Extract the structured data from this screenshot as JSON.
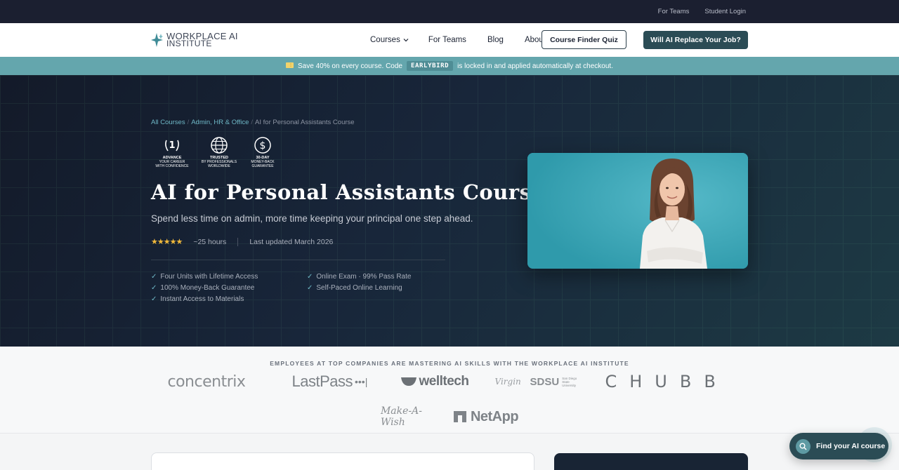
{
  "topbar": {
    "for_teams": "For Teams",
    "student_login": "Student Login"
  },
  "nav": {
    "logo_line1": "WORKPLACE AI",
    "logo_line2": "INSTITUTE",
    "courses": "Courses",
    "for_teams": "For Teams",
    "blog": "Blog",
    "about": "About",
    "quiz_button": "Course Finder Quiz",
    "cta_button": "Will AI Replace Your Job?"
  },
  "promo": {
    "before": "Save 40% on every course. Code",
    "code": "EARLYBIRD",
    "after": "is locked in and applied automatically at checkout."
  },
  "hero": {
    "breadcrumb": {
      "level1": "All Courses",
      "sep": "/",
      "level2": "Admin, HR & Office",
      "current": "AI for Personal Assistants Course"
    },
    "badges": [
      {
        "icon": "laurel-number-one-icon",
        "line1": "ADVANCE",
        "line2": "YOUR CAREER",
        "line3": "WITH CONFIDENCE"
      },
      {
        "icon": "globe-icon",
        "line1": "TRUSTED",
        "line2": "BY PROFESSIONALS",
        "line3": "WORLDWIDE"
      },
      {
        "icon": "dollar-coin-icon",
        "line1": "30-DAY",
        "line2": "MONEY-BACK",
        "line3": "GUARANTEE"
      }
    ],
    "title": "AI for Personal Assistants Course",
    "subtitle": "Spend less time on admin, more time keeping your principal one step ahead.",
    "rating": {
      "stars": 5,
      "stars_text": "★★★★★"
    },
    "hours": "~25 hours",
    "updated": "Last updated March 2026",
    "features": [
      "Four Units with Lifetime Access",
      "Online Exam · 99% Pass Rate",
      "100% Money-Back Guarantee",
      "Self-Paced Online Learning",
      "Instant Access to Materials"
    ],
    "check_glyph": "✓"
  },
  "logos": {
    "title": "EMPLOYEES AT TOP COMPANIES ARE MASTERING AI SKILLS WITH THE WORKPLACE AI INSTITUTE",
    "concentrix": "concentrix",
    "lastpass": "LastPass",
    "lastpass_dots": "•••|",
    "welltech": "welltech",
    "virgin": "Virgin",
    "sdsu": "SDSU",
    "sdsu_sub1": "San Diego State",
    "sdsu_sub2": "University",
    "chubb": "CHUBB",
    "makeawish": "Make-A-Wish",
    "netapp": "NetApp"
  },
  "finder": {
    "label": "Find your AI course",
    "icon": "search-icon"
  },
  "colors": {
    "accent": "#2b4c55",
    "promo": "#64a6ad",
    "link": "#6fb8c7",
    "star": "#f1b93b"
  }
}
